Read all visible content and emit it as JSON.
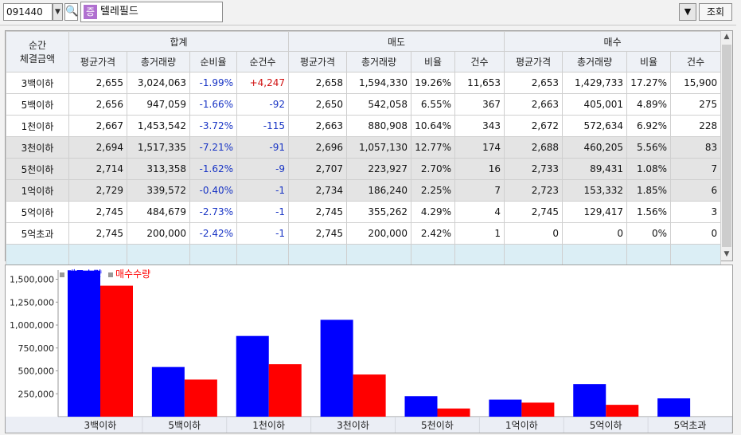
{
  "toolbar": {
    "code": "091440",
    "name": "텔레필드",
    "type_badge": "증",
    "menu_glyph": "▼",
    "query_label": "조회",
    "dropdown_glyph": "▼",
    "search_glyph": "🔍"
  },
  "table": {
    "corner_label_1": "순간",
    "corner_label_2": "체결금액",
    "groups": [
      "합계",
      "매도",
      "매수"
    ],
    "columns": [
      "평균가격",
      "총거래량",
      "순비율",
      "순건수",
      "평균가격",
      "총거래량",
      "비율",
      "건수",
      "평균가격",
      "총거래량",
      "비율",
      "건수"
    ],
    "rows": [
      {
        "label": "3백이하",
        "cells": [
          "2,655",
          "3,024,063",
          "-1.99%",
          "+4,247",
          "2,658",
          "1,594,330",
          "19.26%",
          "11,653",
          "2,653",
          "1,429,733",
          "17.27%",
          "15,900"
        ]
      },
      {
        "label": "5백이하",
        "cells": [
          "2,656",
          "947,059",
          "-1.66%",
          "-92",
          "2,650",
          "542,058",
          "6.55%",
          "367",
          "2,663",
          "405,001",
          "4.89%",
          "275"
        ]
      },
      {
        "label": "1천이하",
        "cells": [
          "2,667",
          "1,453,542",
          "-3.72%",
          "-115",
          "2,663",
          "880,908",
          "10.64%",
          "343",
          "2,672",
          "572,634",
          "6.92%",
          "228"
        ]
      },
      {
        "label": "3천이하",
        "cells": [
          "2,694",
          "1,517,335",
          "-7.21%",
          "-91",
          "2,696",
          "1,057,130",
          "12.77%",
          "174",
          "2,688",
          "460,205",
          "5.56%",
          "83"
        ]
      },
      {
        "label": "5천이하",
        "cells": [
          "2,714",
          "313,358",
          "-1.62%",
          "-9",
          "2,707",
          "223,927",
          "2.70%",
          "16",
          "2,733",
          "89,431",
          "1.08%",
          "7"
        ]
      },
      {
        "label": "1억이하",
        "cells": [
          "2,729",
          "339,572",
          "-0.40%",
          "-1",
          "2,734",
          "186,240",
          "2.25%",
          "7",
          "2,723",
          "153,332",
          "1.85%",
          "6"
        ]
      },
      {
        "label": "5억이하",
        "cells": [
          "2,745",
          "484,679",
          "-2.73%",
          "-1",
          "2,745",
          "355,262",
          "4.29%",
          "4",
          "2,745",
          "129,417",
          "1.56%",
          "3"
        ]
      },
      {
        "label": "5억초과",
        "cells": [
          "2,745",
          "200,000",
          "-2.42%",
          "-1",
          "2,745",
          "200,000",
          "2.42%",
          "1",
          "0",
          "0",
          "0%",
          "0"
        ]
      }
    ]
  },
  "chart_data": {
    "type": "bar",
    "categories": [
      "3백이하",
      "5백이하",
      "1천이하",
      "3천이하",
      "5천이하",
      "1억이하",
      "5억이하",
      "5억초과"
    ],
    "series": [
      {
        "name": "매도수량",
        "color": "#0000ff",
        "values": [
          1594330,
          542058,
          880908,
          1057130,
          223927,
          186240,
          355262,
          200000
        ]
      },
      {
        "name": "매수수량",
        "color": "#ff0000",
        "values": [
          1429733,
          405001,
          572634,
          460205,
          89431,
          153332,
          129417,
          0
        ]
      }
    ],
    "yticks": [
      "250,000",
      "500,000",
      "750,000",
      "1,000,000",
      "1,250,000",
      "1,500,000"
    ],
    "ylim": [
      0,
      1600000
    ],
    "legend_placement": "top-left"
  }
}
